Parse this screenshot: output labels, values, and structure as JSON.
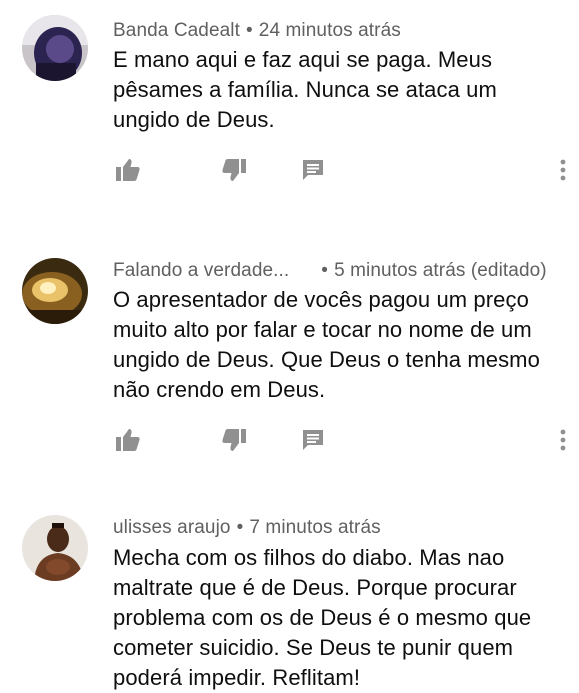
{
  "comments": [
    {
      "author": "Banda Cadealt",
      "separator": "•",
      "time": "24 minutos atrás",
      "text": "E mano aqui e faz aqui se paga.  Meus pêsames a família. Nunca se ataca um ungido de Deus.",
      "avatar_icon": "avatar-person-dark"
    },
    {
      "author": "Falando a verdade...",
      "separator": "•",
      "time": "5 minutos atrás (editado)",
      "text": "O apresentador de vocês pagou um preço muito alto por falar e tocar no nome de um ungido de Deus. Que Deus o tenha mesmo não crendo em Deus.",
      "avatar_icon": "avatar-warm-light"
    },
    {
      "author": "ulisses araujo",
      "separator": "•",
      "time": "7 minutos atrás",
      "text": "Mecha com os filhos do diabo. Mas nao maltrate que é de Deus. Porque procurar problema com os de Deus é o mesmo que cometer suicidio. Se Deus te punir quem poderá impedir. Reflitam!",
      "avatar_icon": "avatar-person-shirtless"
    }
  ],
  "icons": {
    "like": "thumb-up-icon",
    "dislike": "thumb-down-icon",
    "reply": "comment-icon",
    "menu": "more-vertical-icon"
  },
  "colors": {
    "icon": "#909090",
    "meta": "#606060",
    "text": "#0f0f0f"
  }
}
